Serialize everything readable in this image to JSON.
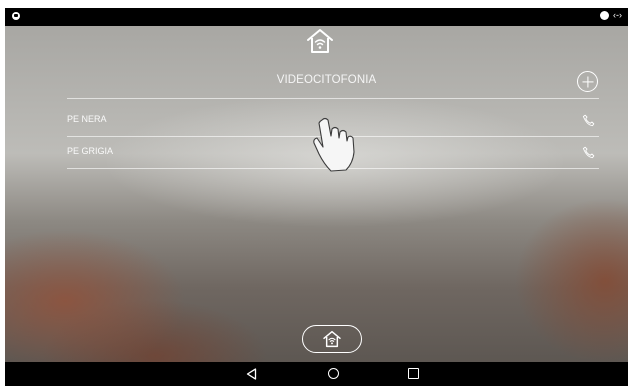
{
  "app": {
    "title": "VIDEOCITOFONIA"
  },
  "status_bar": {
    "right_indicator": "‹-›"
  },
  "list": {
    "items": [
      {
        "label": "PE NERA",
        "icon": "phone-icon"
      },
      {
        "label": "PE GRIGIA",
        "icon": "phone-icon"
      }
    ]
  },
  "icons": {
    "top": "home-wifi-icon",
    "add": "plus-circle-icon",
    "gesture": "hand-tap-icon",
    "bottom": "home-wifi-icon"
  },
  "nav_bar": {
    "back": "back-triangle-icon",
    "home": "home-circle-icon",
    "recents": "recents-square-icon"
  },
  "colors": {
    "text": "#ffffff",
    "status_bar": "#000000",
    "nav_bar": "#000000"
  }
}
